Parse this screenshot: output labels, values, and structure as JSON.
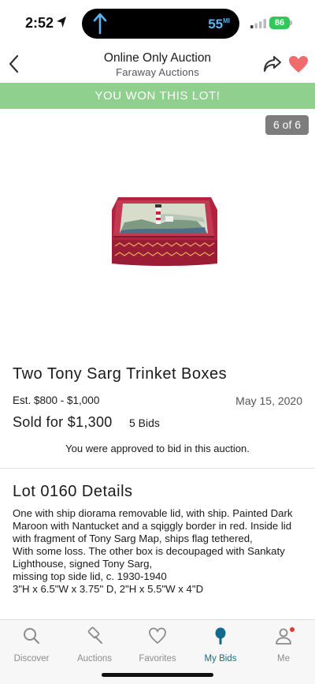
{
  "status_bar": {
    "time": "2:52",
    "navigation_distance": "55",
    "navigation_unit": "MI",
    "battery_level": "86"
  },
  "header": {
    "title": "Online Only Auction",
    "subtitle": "Faraway Auctions"
  },
  "banner": {
    "text": "YOU WON THIS LOT!",
    "color": "#8fd08f"
  },
  "gallery": {
    "counter": "6 of 6"
  },
  "lot": {
    "title": "Two Tony Sarg Trinket Boxes",
    "estimate": "Est. $800 - $1,000",
    "date": "May 15, 2020",
    "sold": "Sold for $1,300",
    "bids": "5 Bids",
    "approval_note": "You were approved to bid in this auction."
  },
  "details": {
    "heading": "Lot 0160 Details",
    "body": "One with ship diorama removable lid, with ship. Painted Dark Maroon with Nantucket and a sqiggly border in red. Inside lid with fragment of Tony Sarg Map, ships flag tethered,\nWith some loss. The other box is decoupaged with Sankaty\nLighthouse, signed Tony Sarg,\nmissing top side lid, c. 1930-1940\n3\"H x 6.5\"W x 3.75\" D, 2\"H x 5.5\"W x 4\"D"
  },
  "tabs": [
    {
      "label": "Discover",
      "icon": "search-icon",
      "active": false
    },
    {
      "label": "Auctions",
      "icon": "gavel-icon",
      "active": false
    },
    {
      "label": "Favorites",
      "icon": "heart-outline-icon",
      "active": false
    },
    {
      "label": "My Bids",
      "icon": "paddle-icon",
      "active": true
    },
    {
      "label": "Me",
      "icon": "person-icon",
      "active": false,
      "has_notification": true
    }
  ],
  "colors": {
    "accent": "#126b8e",
    "heart": "#f06b6b",
    "banner": "#8fd08f"
  }
}
